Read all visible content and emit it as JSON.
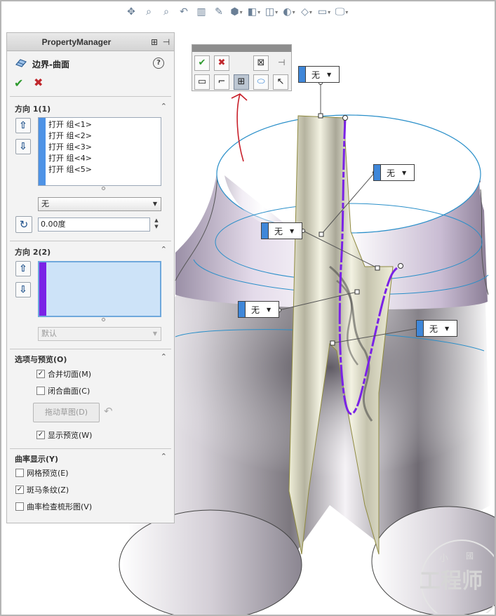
{
  "property_manager": {
    "header_title": "PropertyManager",
    "feature_title": "边界-曲面",
    "direction1": {
      "title": "方向 1(1)",
      "items": [
        "打开 组<1>",
        "打开 组<2>",
        "打开 组<3>",
        "打开 组<4>",
        "打开 组<5>"
      ],
      "tangency_select": "无",
      "angle_value": "0.00度",
      "stripe_color": "#4e93e6"
    },
    "direction2": {
      "title": "方向 2(2)",
      "items": [],
      "tangency_select": "默认",
      "stripe_color": "#7a22e6"
    },
    "options": {
      "title": "选项与预览(O)",
      "merge_tangent_faces": {
        "label": "合并切面(M)",
        "checked": true
      },
      "closed_surface": {
        "label": "闭合曲面(C)",
        "checked": false
      },
      "drag_sketch_label": "拖动草图(D)",
      "show_preview": {
        "label": "显示预览(W)",
        "checked": true
      }
    },
    "curvature_display": {
      "title": "曲率显示(Y)",
      "mesh_preview": {
        "label": "网格预览(E)",
        "checked": false
      },
      "zebra_stripes": {
        "label": "斑马条纹(Z)",
        "checked": true
      },
      "curvature_comb": {
        "label": "曲率检查梳形图(V)",
        "checked": false
      }
    }
  },
  "callouts": [
    {
      "label": "无"
    },
    {
      "label": "无"
    },
    {
      "label": "无"
    },
    {
      "label": "无"
    },
    {
      "label": "无"
    }
  ],
  "watermark_text": "小 国 工程师",
  "colors": {
    "accent_blue": "#3f87d9",
    "accent_purple": "#7a22e6",
    "ok_green": "#2e9a2e",
    "cancel_red": "#c0282d",
    "surface_edge_blue": "#2a8fc9",
    "annotation_red": "#c8202a"
  }
}
